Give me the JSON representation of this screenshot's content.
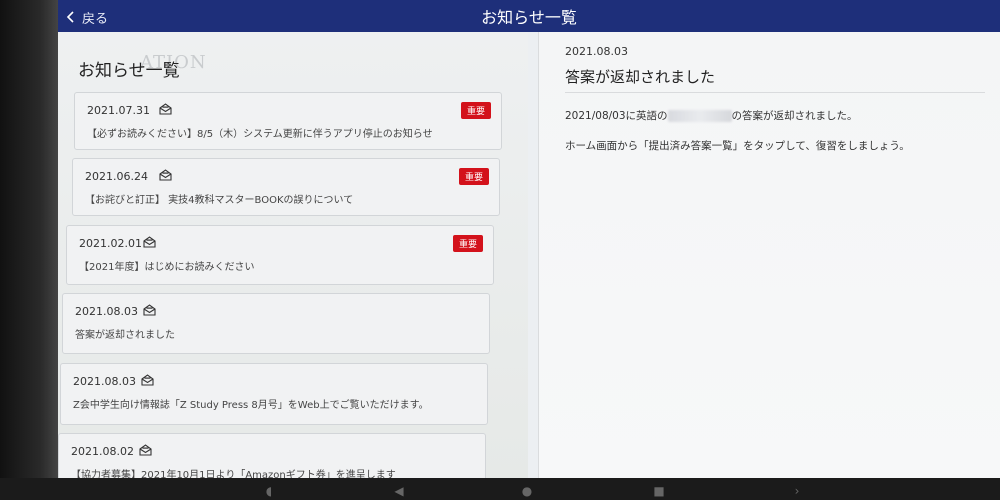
{
  "header": {
    "back_label": "戻る",
    "title": "お知らせ一覧"
  },
  "list": {
    "title": "お知らせ一覧",
    "watermark": "ATION",
    "items": [
      {
        "date": "2021.07.31",
        "badge": "重要",
        "title": "【必ずお読みください】8/5（木）システム更新に伴うアプリ停止のお知らせ"
      },
      {
        "date": "2021.06.24",
        "badge": "重要",
        "title": "【お詫びと訂正】 実技4教科マスターBOOKの誤りについて"
      },
      {
        "date": "2021.02.01",
        "badge": "重要",
        "title": "【2021年度】はじめにお読みください"
      },
      {
        "date": "2021.08.03",
        "badge": "",
        "title": "答案が返却されました"
      },
      {
        "date": "2021.08.03",
        "badge": "",
        "title": "Z会中学生向け情報誌「Z Study Press 8月号」をWeb上でご覧いただけます。"
      },
      {
        "date": "2021.08.02",
        "badge": "",
        "title": "【協力者募集】2021年10月1日より「Amazonギフト券」を進呈します"
      }
    ]
  },
  "detail": {
    "date": "2021.08.03",
    "title": "答案が返却されました",
    "body_prefix": "2021/08/03に英語の",
    "body_suffix": "の答案が返却されました。",
    "body_line2": "ホーム画面から「提出済み答案一覧」をタップして、復習をしましょう。"
  },
  "icons": {
    "back": "chevron-left-icon",
    "mail": "mail-icon"
  },
  "colors": {
    "header": "#1e2f7a",
    "badge": "#d3121b"
  }
}
